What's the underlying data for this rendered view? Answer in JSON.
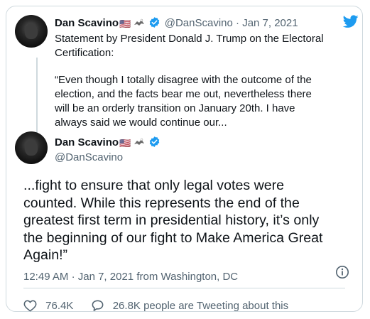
{
  "quoted_tweet": {
    "author_name": "Dan Scavino",
    "flag_emoji": "🇺🇸",
    "handle": "@DanScavino",
    "separator": "·",
    "date": "Jan 7, 2021",
    "text_line1": "Statement by President Donald J. Trump on the Electoral",
    "text_line2": "Certification:",
    "quote_line1": "“Even though I totally disagree with the outcome of the",
    "quote_line2": "election, and the facts bear me out, nevertheless there",
    "quote_line3": "will be an orderly transition on January 20th. I have",
    "quote_line4": "always said we would continue our..."
  },
  "main_tweet": {
    "author_name": "Dan Scavino",
    "flag_emoji": "🇺🇸",
    "handle": "@DanScavino",
    "text_line1": "...fight to ensure that only legal votes were",
    "text_line2": "counted. While this represents the end of the",
    "text_line3": "greatest first term in presidential history, it’s only",
    "text_line4": "the beginning of our fight to Make America Great",
    "text_line5": "Again!”",
    "time": "12:49 AM",
    "separator": "·",
    "date": "Jan 7, 2021",
    "source_prefix": "from",
    "location": "Washington, DC",
    "likes": "76.4K",
    "tweeting_count": "26.8K people are Tweeting about this"
  },
  "colors": {
    "twitter_blue": "#1d9bf0",
    "text_primary": "#0f1419",
    "text_secondary": "#536471",
    "border": "#cfd9de"
  },
  "icons": [
    "twitter-bird-icon",
    "verified-badge-icon",
    "flag-icon",
    "eagle-icon",
    "info-icon",
    "heart-icon",
    "speech-bubble-icon"
  ]
}
